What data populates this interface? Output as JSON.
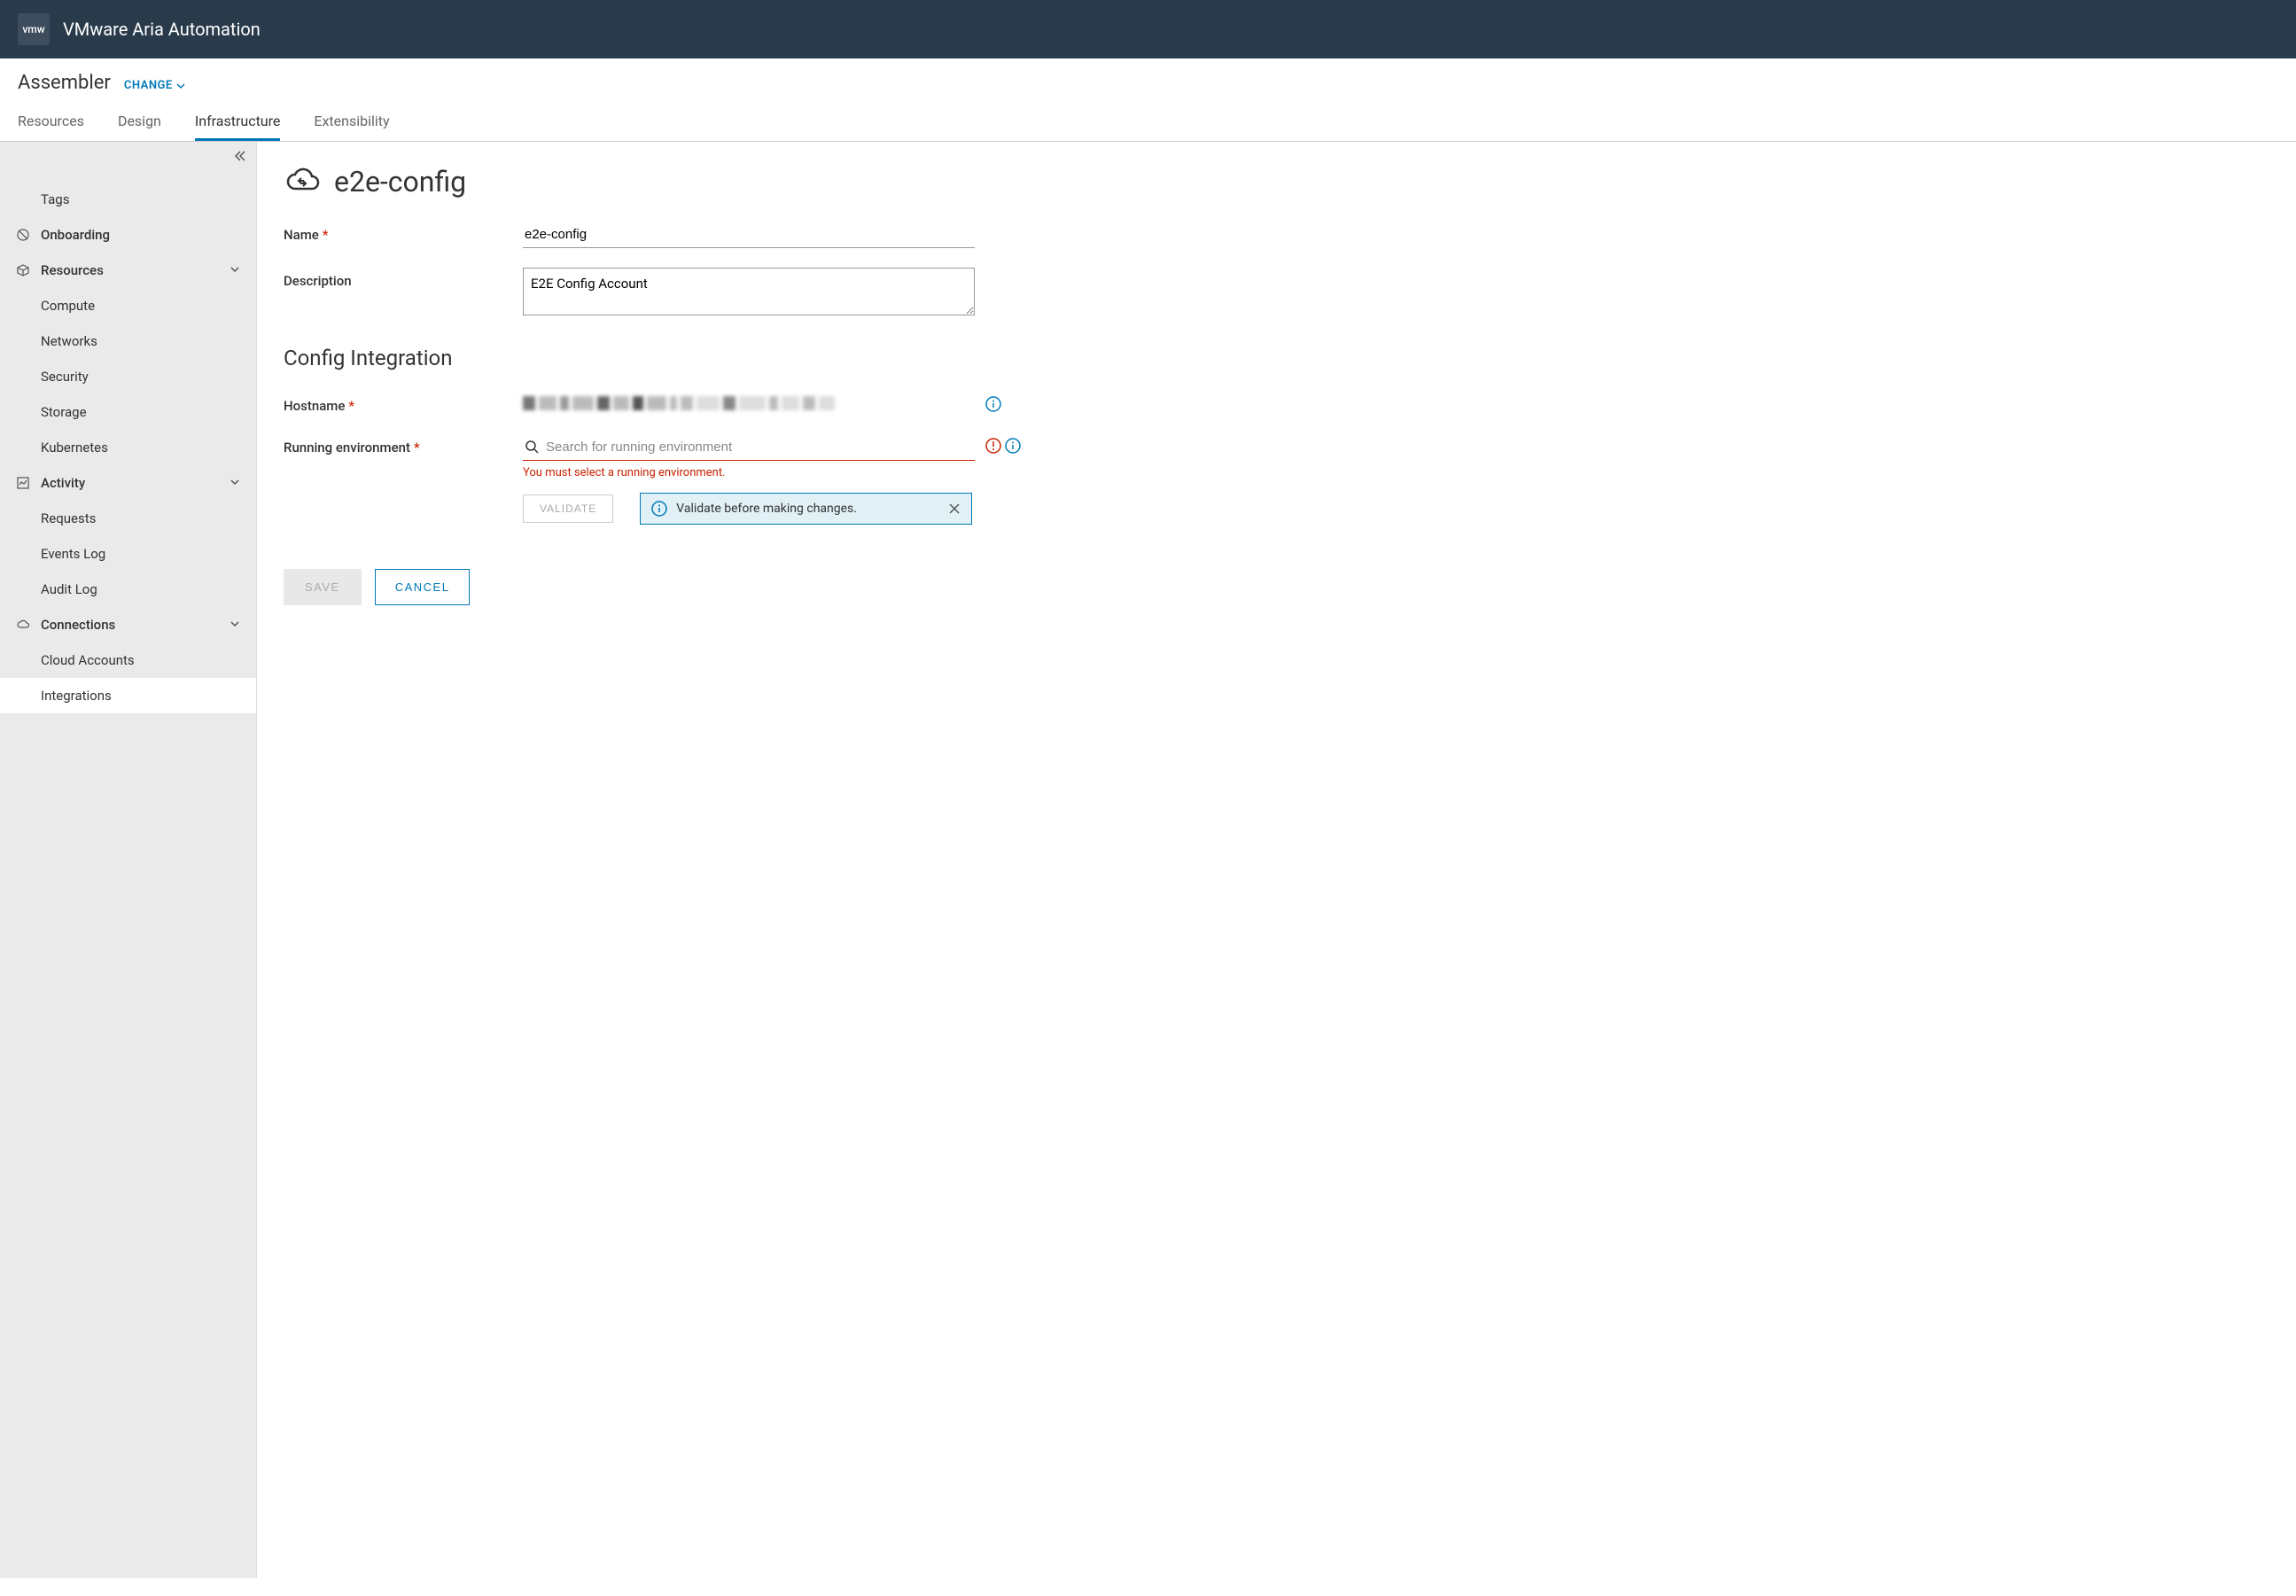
{
  "header": {
    "logo": "vmw",
    "product": "VMware Aria Automation"
  },
  "subheader": {
    "context": "Assembler",
    "change_label": "CHANGE"
  },
  "tabs": [
    {
      "label": "Resources",
      "active": false
    },
    {
      "label": "Design",
      "active": false
    },
    {
      "label": "Infrastructure",
      "active": true
    },
    {
      "label": "Extensibility",
      "active": false
    }
  ],
  "sidebar": {
    "tags": "Tags",
    "onboarding": "Onboarding",
    "resources": {
      "label": "Resources",
      "items": [
        "Compute",
        "Networks",
        "Security",
        "Storage",
        "Kubernetes"
      ]
    },
    "activity": {
      "label": "Activity",
      "items": [
        "Requests",
        "Events Log",
        "Audit Log"
      ]
    },
    "connections": {
      "label": "Connections",
      "items": [
        "Cloud Accounts",
        "Integrations"
      ]
    }
  },
  "page": {
    "title": "e2e-config",
    "section_title": "Config Integration",
    "labels": {
      "name": "Name",
      "description": "Description",
      "hostname": "Hostname",
      "running_env": "Running environment"
    },
    "values": {
      "name": "e2e-config",
      "description": "E2E Config Account"
    },
    "placeholders": {
      "running_env": "Search for running environment"
    },
    "errors": {
      "running_env": "You must select a running environment."
    },
    "buttons": {
      "validate": "VALIDATE",
      "save": "SAVE",
      "cancel": "CANCEL"
    },
    "alert": "Validate before making changes."
  }
}
